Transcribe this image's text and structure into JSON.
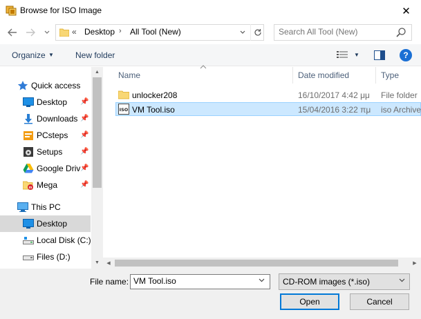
{
  "window": {
    "title": "Browse for ISO Image",
    "close_label": "✕"
  },
  "address": {
    "overflow": "«",
    "crumbs": [
      "Desktop",
      "All Tool (New)"
    ],
    "separator": "›"
  },
  "search": {
    "placeholder": "Search All Tool (New)"
  },
  "toolbar": {
    "organize_label": "Organize",
    "new_folder_label": "New folder",
    "help_label": "?"
  },
  "sidebar": {
    "items": [
      {
        "label": "Quick access",
        "icon": "star-icon"
      },
      {
        "label": "Desktop",
        "icon": "desktop-icon",
        "pinned": true
      },
      {
        "label": "Downloads",
        "icon": "download-icon",
        "pinned": true
      },
      {
        "label": "PCsteps",
        "icon": "folder-icon",
        "pinned": true
      },
      {
        "label": "Setups",
        "icon": "setups-icon",
        "pinned": true
      },
      {
        "label": "Google Driv",
        "icon": "google-drive-icon",
        "pinned": true
      },
      {
        "label": "Mega",
        "icon": "mega-icon",
        "pinned": true
      },
      {
        "label": "This PC",
        "icon": "pc-icon"
      },
      {
        "label": "Desktop",
        "icon": "desktop-icon",
        "selected": true
      },
      {
        "label": "Local Disk (C:)",
        "icon": "drive-icon"
      },
      {
        "label": "Files (D:)",
        "icon": "drive-icon"
      }
    ]
  },
  "columns": {
    "name": "Name",
    "date": "Date modified",
    "type": "Type"
  },
  "files": [
    {
      "name": "unlocker208",
      "date": "16/10/2017 4:42 μμ",
      "type": "File folder",
      "icon": "folder-icon",
      "selected": false
    },
    {
      "name": "VM Tool.iso",
      "date": "15/04/2016 3:22 πμ",
      "type": "iso Archive",
      "icon": "iso-file-icon",
      "selected": true
    }
  ],
  "footer": {
    "filename_label": "File name:",
    "filename_value": "VM Tool.iso",
    "filetype_value": "CD-ROM images (*.iso)",
    "open_label": "Open",
    "cancel_label": "Cancel"
  },
  "colors": {
    "accent": "#0078d7",
    "selection_bg": "#cce8ff",
    "selection_border": "#99d1ff",
    "folder_yellow": "#f8d775"
  }
}
